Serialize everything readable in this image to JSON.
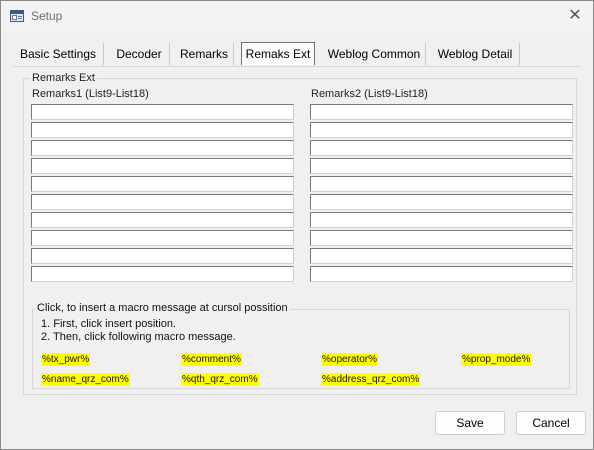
{
  "window": {
    "title": "Setup",
    "close_glyph": "✕"
  },
  "tabs": [
    {
      "label": "Basic Settings",
      "active": false
    },
    {
      "label": "Decoder",
      "active": false
    },
    {
      "label": "Remarks",
      "active": false
    },
    {
      "label": "Remaks Ext",
      "active": true
    },
    {
      "label": "Weblog Common",
      "active": false
    },
    {
      "label": "Weblog Detail",
      "active": false
    }
  ],
  "group": {
    "title": "Remarks Ext",
    "col1_label": "Remarks1 (List9-List18)",
    "col2_label": "Remarks2 (List9-List18)",
    "col1_values": [
      "",
      "",
      "",
      "",
      "",
      "",
      "",
      "",
      "",
      ""
    ],
    "col2_values": [
      "",
      "",
      "",
      "",
      "",
      "",
      "",
      "",
      "",
      ""
    ]
  },
  "macro_group": {
    "title": "Click, to insert a macro message at cursol possition",
    "step1": "1. First, click insert position.",
    "step2": "2. Then, click following macro message.",
    "macros": [
      "%tx_pwr%",
      "%comment%",
      "%operator%",
      "%prop_mode%",
      "%name_qrz_com%",
      "%qth_qrz_com%",
      "%address_qrz_com%"
    ],
    "highlight_color": "#ffff00"
  },
  "buttons": {
    "save": "Save",
    "cancel": "Cancel"
  }
}
